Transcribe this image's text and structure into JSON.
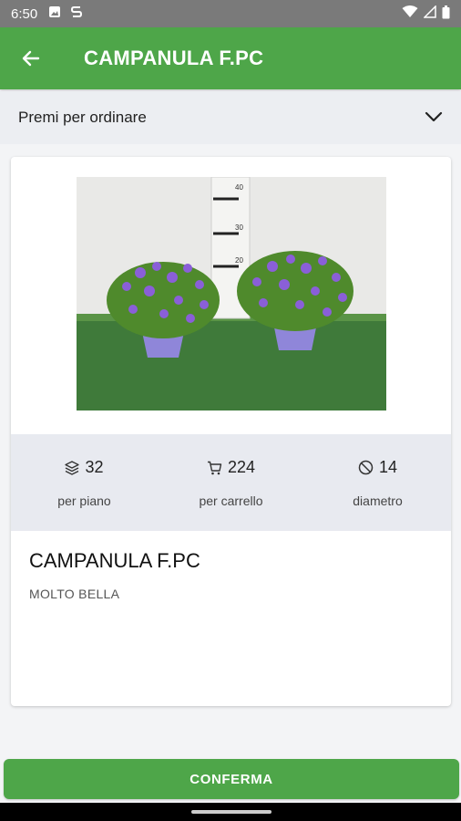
{
  "status_bar": {
    "time": "6:50"
  },
  "app_bar": {
    "title": "CAMPANULA F.PC"
  },
  "sort": {
    "label": "Premi per ordinare"
  },
  "stats": [
    {
      "icon": "layers-icon",
      "value": "32",
      "label": "per piano"
    },
    {
      "icon": "cart-icon",
      "value": "224",
      "label": "per carrello"
    },
    {
      "icon": "diameter-icon",
      "value": "14",
      "label": "diametro"
    }
  ],
  "product": {
    "title": "CAMPANULA F.PC",
    "description": "MOLTO BELLA"
  },
  "ruler_labels": [
    "40",
    "30",
    "20"
  ],
  "colors": {
    "primary": "#4ea649",
    "stats_bg": "#e8eaf0"
  },
  "confirm_button": {
    "label": "CONFERMA"
  }
}
